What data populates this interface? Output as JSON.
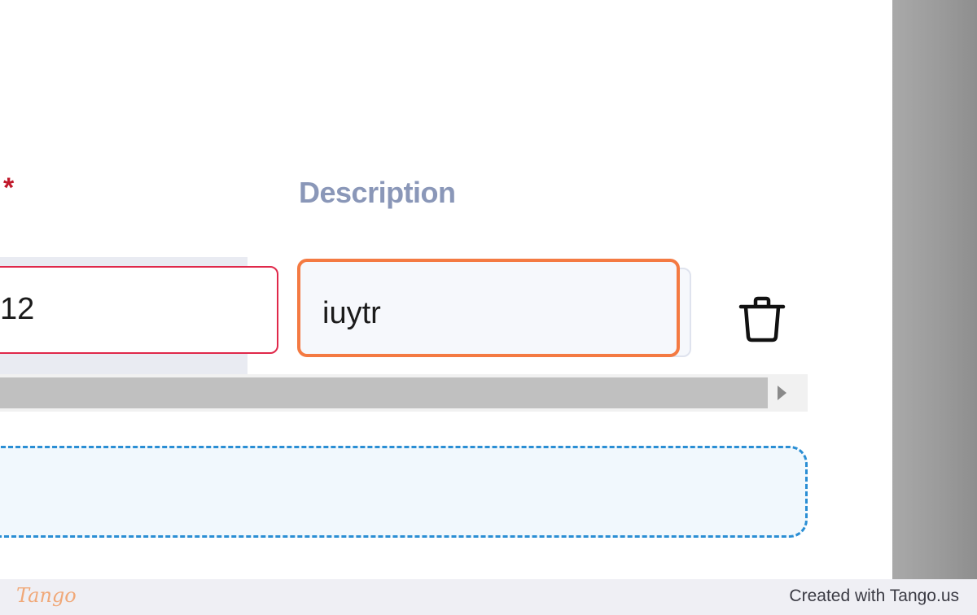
{
  "form": {
    "required_marker": "*",
    "description_label": "Description",
    "left_field_value": "12",
    "description_value": "iuytr"
  },
  "icons": {
    "delete": "trash-icon",
    "scroll_right": "triangle-right-icon"
  },
  "footer": {
    "logo_text": "Tango",
    "credit": "Created with Tango.us"
  },
  "colors": {
    "highlight": "#f47a42",
    "error_border": "#e0284a",
    "required_star": "#c0182a",
    "label": "#8a97b8",
    "dropzone_border": "#2a8ed4"
  }
}
